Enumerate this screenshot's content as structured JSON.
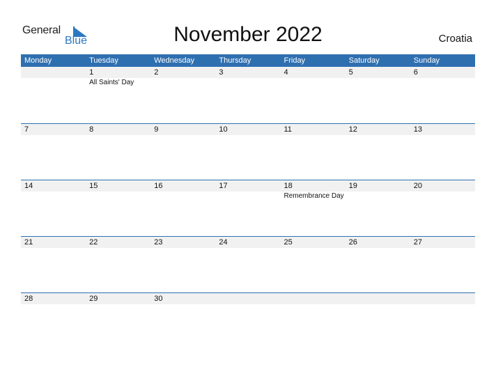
{
  "logo": {
    "word1": "General",
    "word2": "Blue"
  },
  "header": {
    "title": "November 2022",
    "country": "Croatia"
  },
  "colors": {
    "accent": "#2e6fb0",
    "date_strip": "#f1f1f1",
    "logo_blue": "#2a78c2"
  },
  "weekdays": [
    "Monday",
    "Tuesday",
    "Wednesday",
    "Thursday",
    "Friday",
    "Saturday",
    "Sunday"
  ],
  "weeks": [
    [
      {
        "day": ""
      },
      {
        "day": "1",
        "holiday": "All Saints' Day"
      },
      {
        "day": "2"
      },
      {
        "day": "3"
      },
      {
        "day": "4"
      },
      {
        "day": "5"
      },
      {
        "day": "6"
      }
    ],
    [
      {
        "day": "7"
      },
      {
        "day": "8"
      },
      {
        "day": "9"
      },
      {
        "day": "10"
      },
      {
        "day": "11"
      },
      {
        "day": "12"
      },
      {
        "day": "13"
      }
    ],
    [
      {
        "day": "14"
      },
      {
        "day": "15"
      },
      {
        "day": "16"
      },
      {
        "day": "17"
      },
      {
        "day": "18",
        "holiday": "Remembrance Day"
      },
      {
        "day": "19"
      },
      {
        "day": "20"
      }
    ],
    [
      {
        "day": "21"
      },
      {
        "day": "22"
      },
      {
        "day": "23"
      },
      {
        "day": "24"
      },
      {
        "day": "25"
      },
      {
        "day": "26"
      },
      {
        "day": "27"
      }
    ],
    [
      {
        "day": "28"
      },
      {
        "day": "29"
      },
      {
        "day": "30"
      },
      {
        "day": ""
      },
      {
        "day": ""
      },
      {
        "day": ""
      },
      {
        "day": ""
      }
    ]
  ]
}
